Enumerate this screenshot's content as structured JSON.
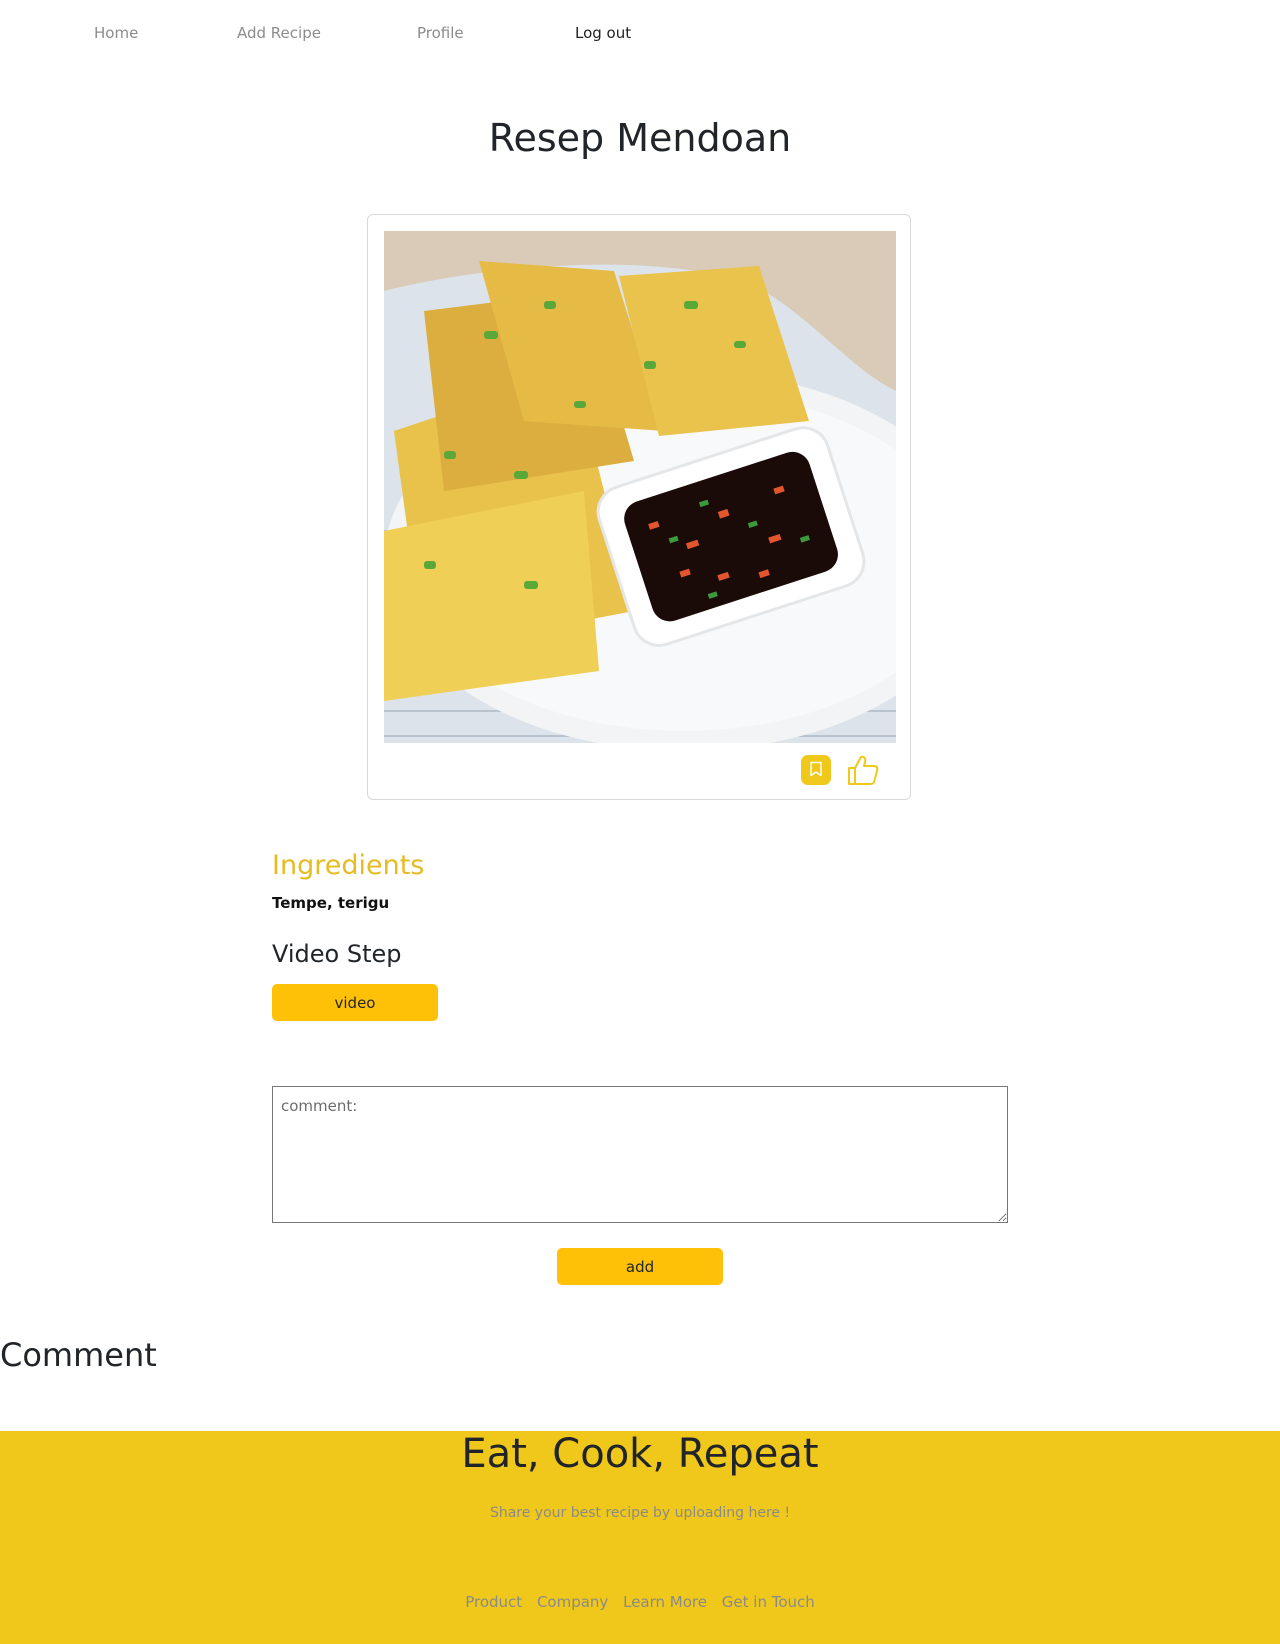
{
  "nav": {
    "items": [
      {
        "label": "Home"
      },
      {
        "label": "Add Recipe"
      },
      {
        "label": "Profile"
      },
      {
        "label": "Log out"
      }
    ]
  },
  "recipe": {
    "title": "Resep Mendoan",
    "ingredients_heading": "Ingredients",
    "ingredients": "Tempe, terigu",
    "video_heading": "Video Step",
    "video_button": "video"
  },
  "comment_form": {
    "placeholder": "comment:",
    "add_button": "add"
  },
  "comments": {
    "heading": "Comment"
  },
  "footer": {
    "slogan": "Eat, Cook, Repeat",
    "subtitle": "Share your best recipe by uploading here !",
    "links": [
      "Product",
      "Company",
      "Learn More",
      "Get in Touch"
    ]
  },
  "colors": {
    "accent": "#efc81b",
    "button": "#ffc107",
    "ingredients_heading": "#e5bc22"
  },
  "icons": {
    "save": "bookmark-icon",
    "like": "thumbs-up-icon"
  }
}
